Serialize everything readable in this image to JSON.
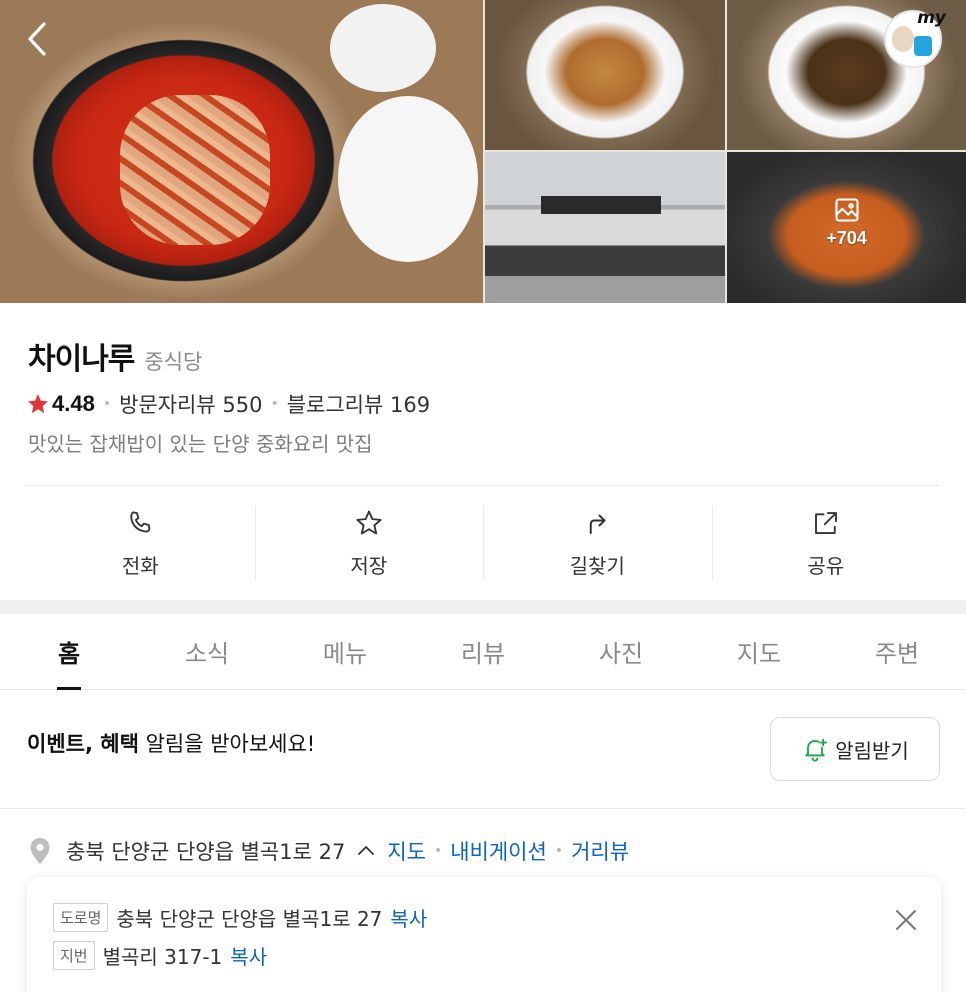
{
  "gallery": {
    "photo_count": "+704",
    "my_label": "my"
  },
  "place": {
    "name": "차이나루",
    "category": "중식당",
    "rating": "4.48",
    "visitor_reviews": "방문자리뷰 550",
    "blog_reviews": "블로그리뷰 169",
    "description": "맛있는 잡채밥이 있는 단양 중화요리 맛집"
  },
  "actions": [
    {
      "label": "전화",
      "icon": "phone-icon"
    },
    {
      "label": "저장",
      "icon": "star-outline-icon"
    },
    {
      "label": "길찾기",
      "icon": "directions-icon"
    },
    {
      "label": "공유",
      "icon": "share-icon"
    }
  ],
  "tabs": [
    "홈",
    "소식",
    "메뉴",
    "리뷰",
    "사진",
    "지도",
    "주변"
  ],
  "active_tab": "홈",
  "notice": {
    "text_bold": "이벤트, 혜택",
    "text_rest": " 알림을 받아보세요!",
    "button": "알림받기"
  },
  "address": {
    "main": "충북 단양군 단양읍 별곡1로 27",
    "links": [
      "지도",
      "내비게이션",
      "거리뷰"
    ],
    "road_tag": "도로명",
    "road_address": "충북 단양군 단양읍 별곡1로 27",
    "lot_tag": "지번",
    "lot_address": "별곡리 317-1",
    "copy_label": "복사"
  },
  "colors": {
    "accent_red": "#e8333a",
    "link_blue": "#0b63c4",
    "bell_green": "#1fa84a"
  }
}
